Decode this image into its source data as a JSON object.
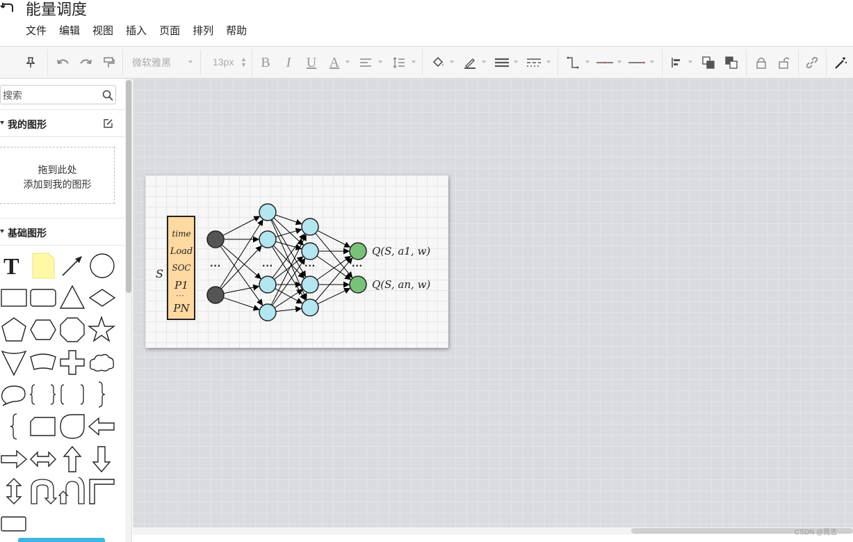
{
  "app": {
    "title": "能量调度",
    "menu": [
      "文件",
      "编辑",
      "视图",
      "插入",
      "页面",
      "排列",
      "帮助"
    ]
  },
  "toolbar": {
    "font_family": "微软雅黑",
    "font_size": "13px",
    "bold": "B",
    "italic": "I",
    "underline": "U",
    "font_color": "A"
  },
  "sidebar": {
    "search_placeholder": "搜索",
    "my_shapes_label": "我的图形",
    "drop_line1": "拖到此处",
    "drop_line2": "添加到我的图形",
    "basic_shapes_label": "基础图形",
    "accent_color": "#3eb6e4"
  },
  "diagram": {
    "state_label": "S",
    "inputs": [
      "time",
      "Load",
      "SOC",
      "P1",
      "···",
      "PN"
    ],
    "ellipsis": "···",
    "outputs": [
      "Q(S, a1, w)",
      "Q(S, an, w)"
    ],
    "colors": {
      "input_box": "#ffd9a0",
      "input_node": "#555555",
      "hidden_node": "#b3e6f0",
      "output_node": "#78c378"
    }
  },
  "watermark": "CSDN @晁志"
}
